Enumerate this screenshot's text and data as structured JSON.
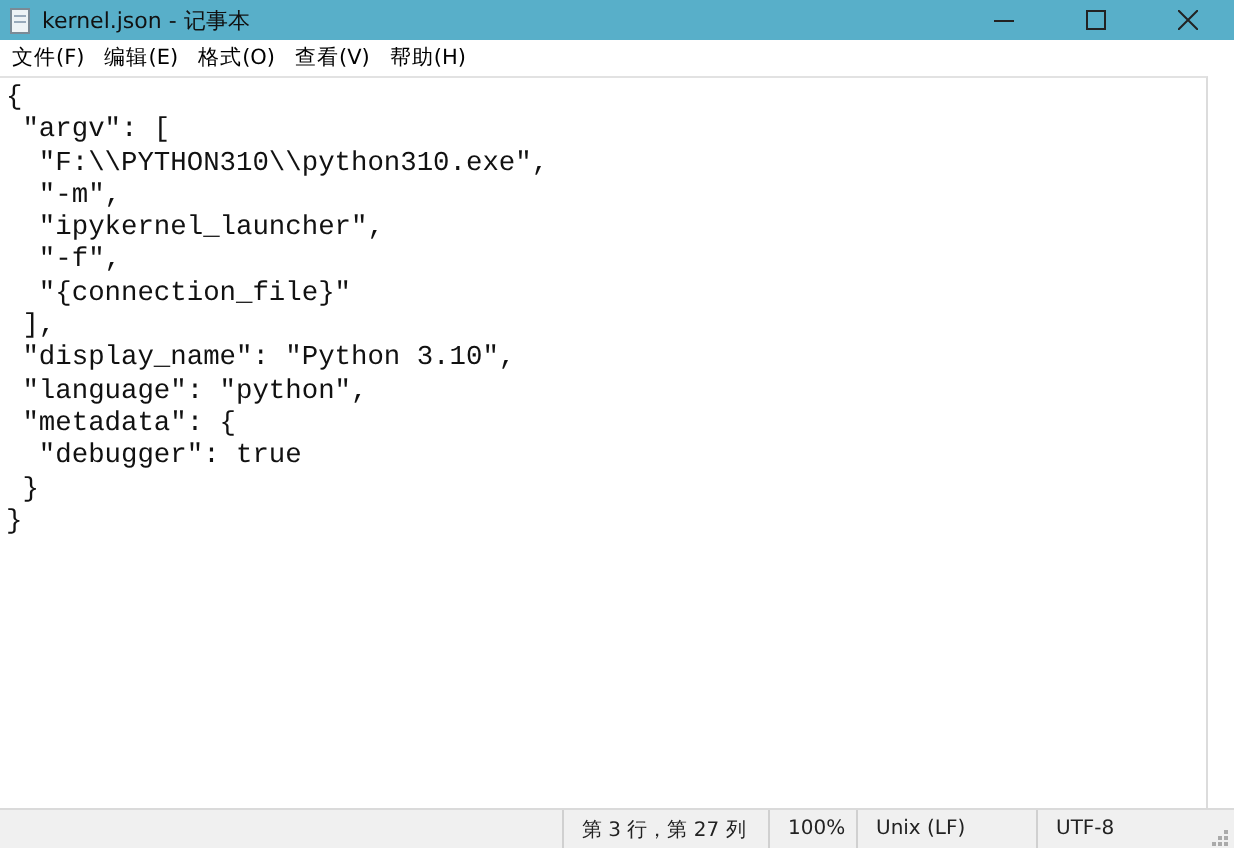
{
  "window": {
    "title": "kernel.json - 记事本"
  },
  "menu": [
    "文件(F)",
    "编辑(E)",
    "格式(O)",
    "查看(V)",
    "帮助(H)"
  ],
  "editor": {
    "lines": [
      "{",
      " \"argv\": [",
      "  \"F:\\\\PYTHON310\\\\python310.exe\",",
      "  \"-m\",",
      "  \"ipykernel_launcher\",",
      "  \"-f\",",
      "  \"{connection_file}\"",
      " ],",
      " \"display_name\": \"Python 3.10\",",
      " \"language\": \"python\",",
      " \"metadata\": {",
      "  \"debugger\": true",
      " }",
      "}"
    ]
  },
  "status_bar": {
    "position": "第 3 行，第 27 列",
    "zoom": "100%",
    "line_ending": "Unix (LF)",
    "encoding": "UTF-8"
  }
}
